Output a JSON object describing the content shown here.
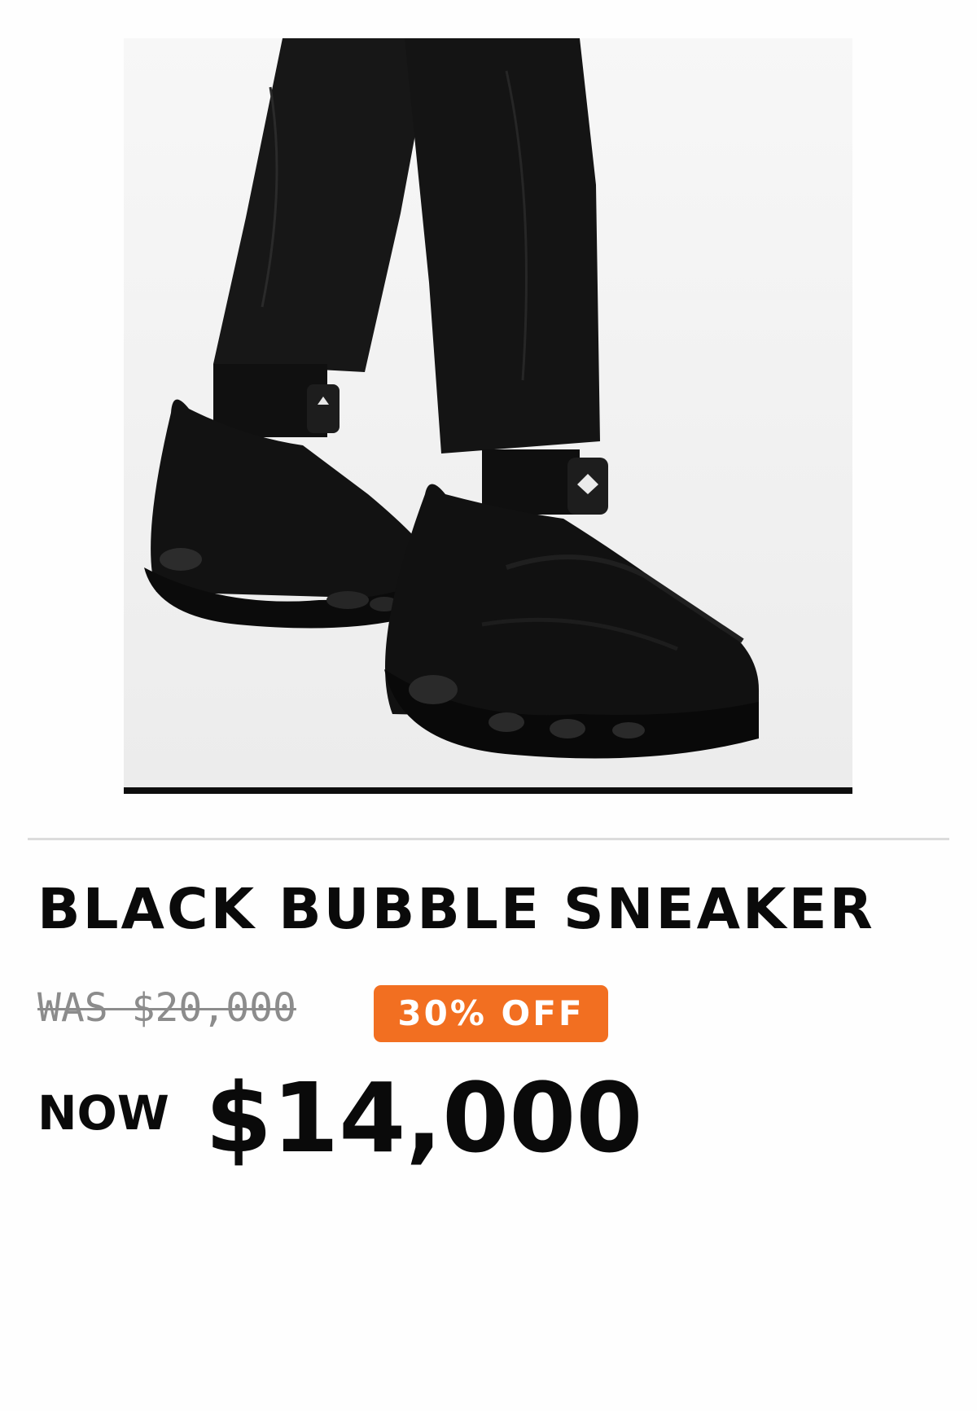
{
  "product": {
    "image_alt": "Black bubble sneakers worn with black trousers",
    "title": "BLACK BUBBLE SNEAKER"
  },
  "pricing": {
    "was_price": "WAS $20,000",
    "discount_badge": "30% OFF",
    "now_label": "NOW",
    "now_price": "$14,000"
  },
  "colors": {
    "badge_background": "#f26f21",
    "text": "#0a0a0a",
    "was_price_text": "#8c8c8c"
  }
}
